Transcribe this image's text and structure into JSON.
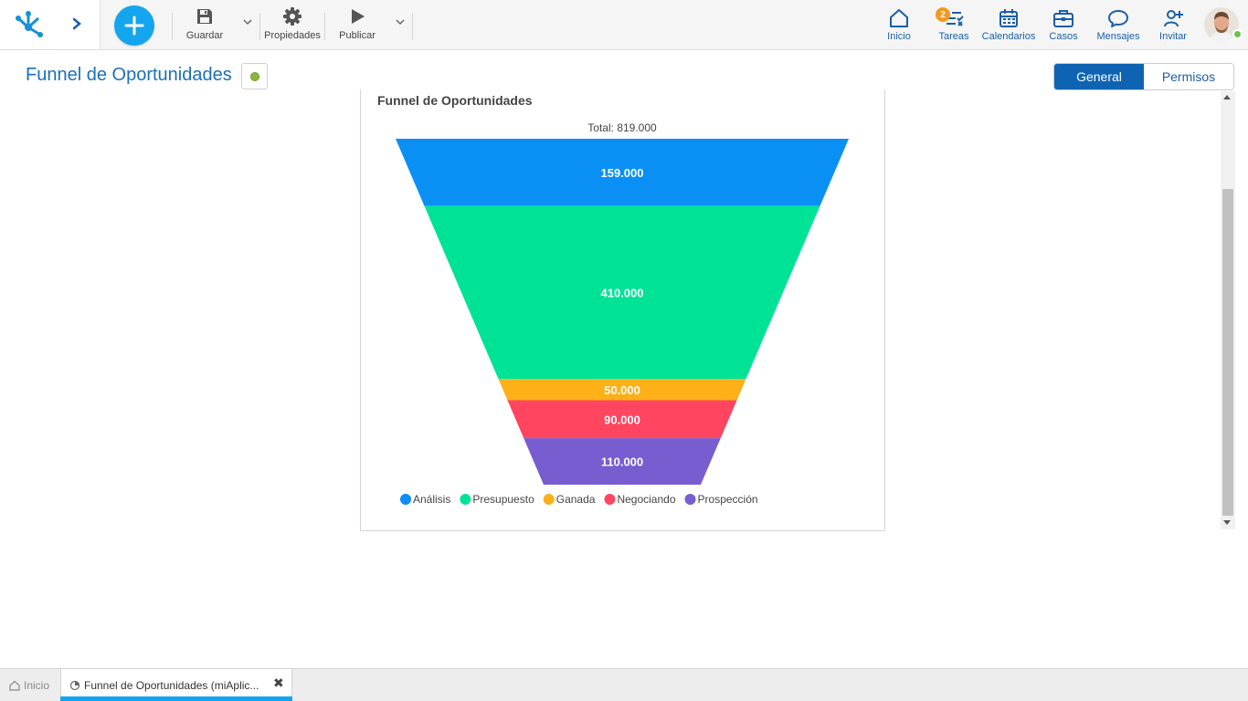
{
  "toolbar": {
    "guardar_label": "Guardar",
    "propiedades_label": "Propiedades",
    "publicar_label": "Publicar"
  },
  "nav": {
    "inicio_label": "Inicio",
    "tareas_label": "Tareas",
    "tareas_badge": "2",
    "calendarios_label": "Calendarios",
    "casos_label": "Casos",
    "mensajes_label": "Mensajes",
    "invitar_label": "Invitar"
  },
  "page": {
    "title": "Funnel de Oportunidades"
  },
  "tabs": {
    "general": "General",
    "permisos": "Permisos"
  },
  "chart_data": {
    "type": "funnel",
    "title": "Funnel de Oportunidades",
    "total_label": "Total: 819.000",
    "categories": [
      "Análisis",
      "Presupuesto",
      "Ganada",
      "Negociando",
      "Prospección"
    ],
    "values": [
      159000,
      410000,
      50000,
      90000,
      110000
    ],
    "value_labels": [
      "159.000",
      "410.000",
      "50.000",
      "90.000",
      "110.000"
    ],
    "colors": [
      "#0a8ff5",
      "#00e396",
      "#feb019",
      "#ff4560",
      "#775dd0"
    ],
    "legend_position": "bottom-left"
  },
  "bottom_tabs": {
    "home_label": "Inicio",
    "active_label": "Funnel de Oportunidades (miAplic..."
  }
}
